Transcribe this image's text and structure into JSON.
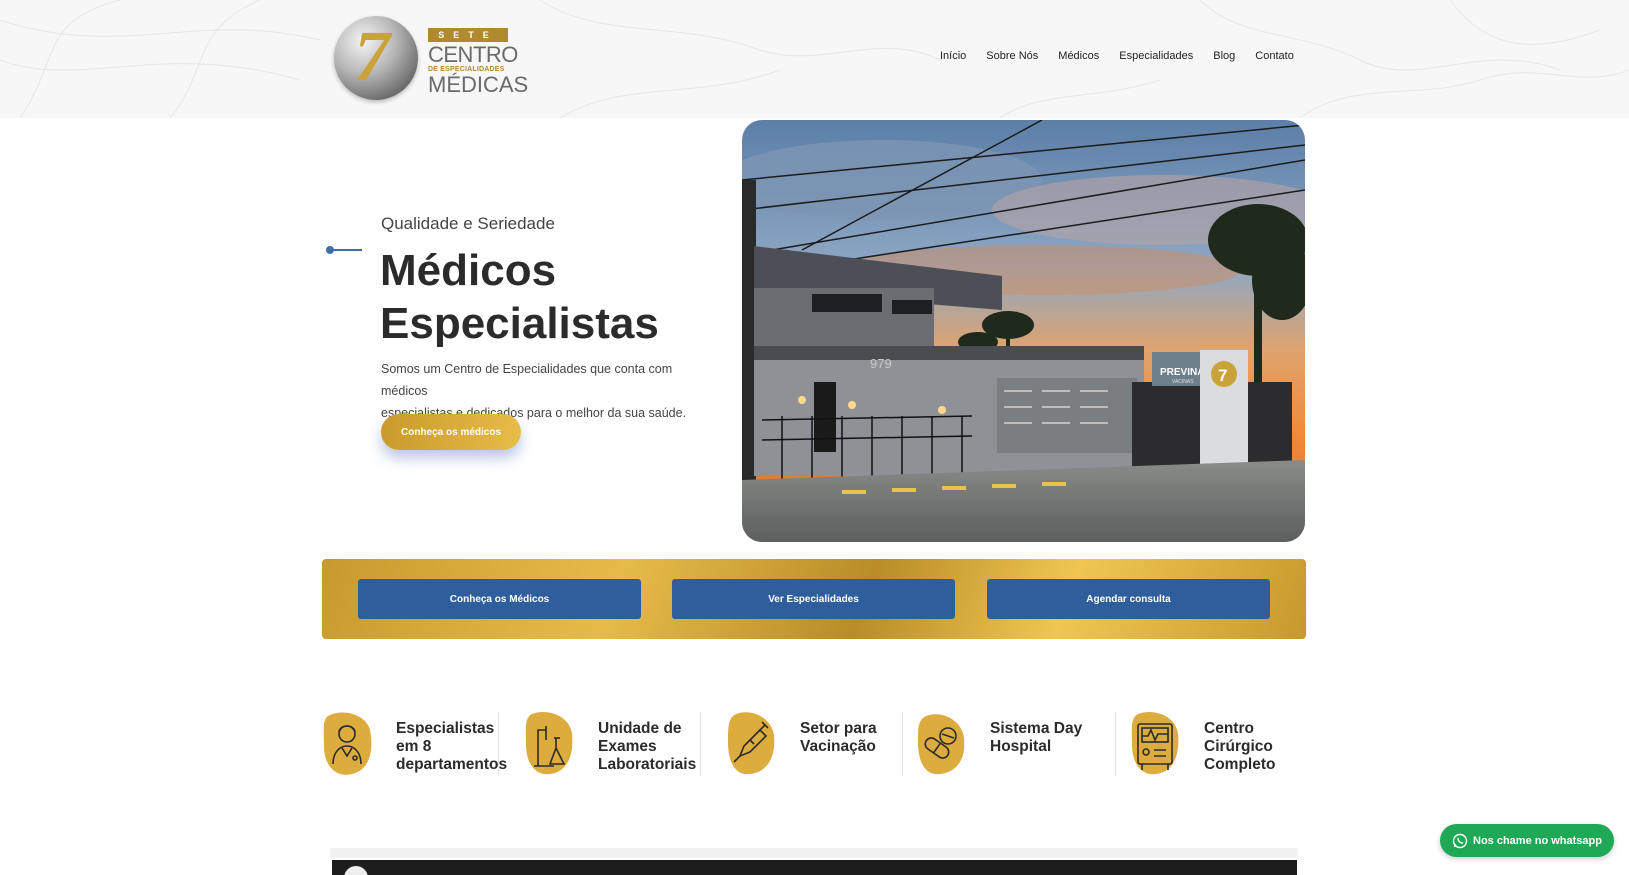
{
  "header": {
    "logo": {
      "mark": "7",
      "top_word": "SETE",
      "line1": "CENTRO",
      "line2": "DE ESPECIALIDADES",
      "line3": "MÉDICAS"
    },
    "nav": [
      {
        "label": "Início"
      },
      {
        "label": "Sobre Nós"
      },
      {
        "label": "Médicos"
      },
      {
        "label": "Especialidades"
      },
      {
        "label": "Blog"
      },
      {
        "label": "Contato"
      }
    ]
  },
  "hero": {
    "subtitle": "Qualidade e Seriedade",
    "title_line1": "Médicos",
    "title_line2": "Especialistas",
    "description_line1": "Somos um Centro de Especialidades que conta com médicos",
    "description_line2": "especialistas e dedicados para o melhor da sua saúde.",
    "button_label": "Conheça os médicos",
    "photo": {
      "building_number": "979",
      "sign_brand": "PREVINA",
      "sign_sub": "VACINAS",
      "sign_mark": "7"
    }
  },
  "band": {
    "buttons": [
      {
        "label": "Conheça os Médicos"
      },
      {
        "label": "Ver Especialidades"
      },
      {
        "label": "Agendar consulta"
      }
    ]
  },
  "features": [
    {
      "icon": "doctor-icon",
      "line1": "Especialistas",
      "line2": "em 8",
      "line3": "departamentos"
    },
    {
      "icon": "microscope-flask-icon",
      "line1": "Unidade de",
      "line2": "Exames",
      "line3": "Laboratoriais"
    },
    {
      "icon": "syringe-icon",
      "line1": "Setor para",
      "line2": "Vacinação",
      "line3": ""
    },
    {
      "icon": "pills-icon",
      "line1": "Sistema Day",
      "line2": "Hospital",
      "line3": ""
    },
    {
      "icon": "medical-monitor-icon",
      "line1": "Centro",
      "line2": "Cirúrgico",
      "line3": "Completo"
    }
  ],
  "whatsapp": {
    "label": "Nos chame no whatsapp",
    "icon": "whatsapp-icon"
  },
  "colors": {
    "gold": "#d9ab3b",
    "blue_button": "#2e5f9c",
    "whatsapp_green": "#1fa855",
    "heading": "#2b2b2b"
  }
}
